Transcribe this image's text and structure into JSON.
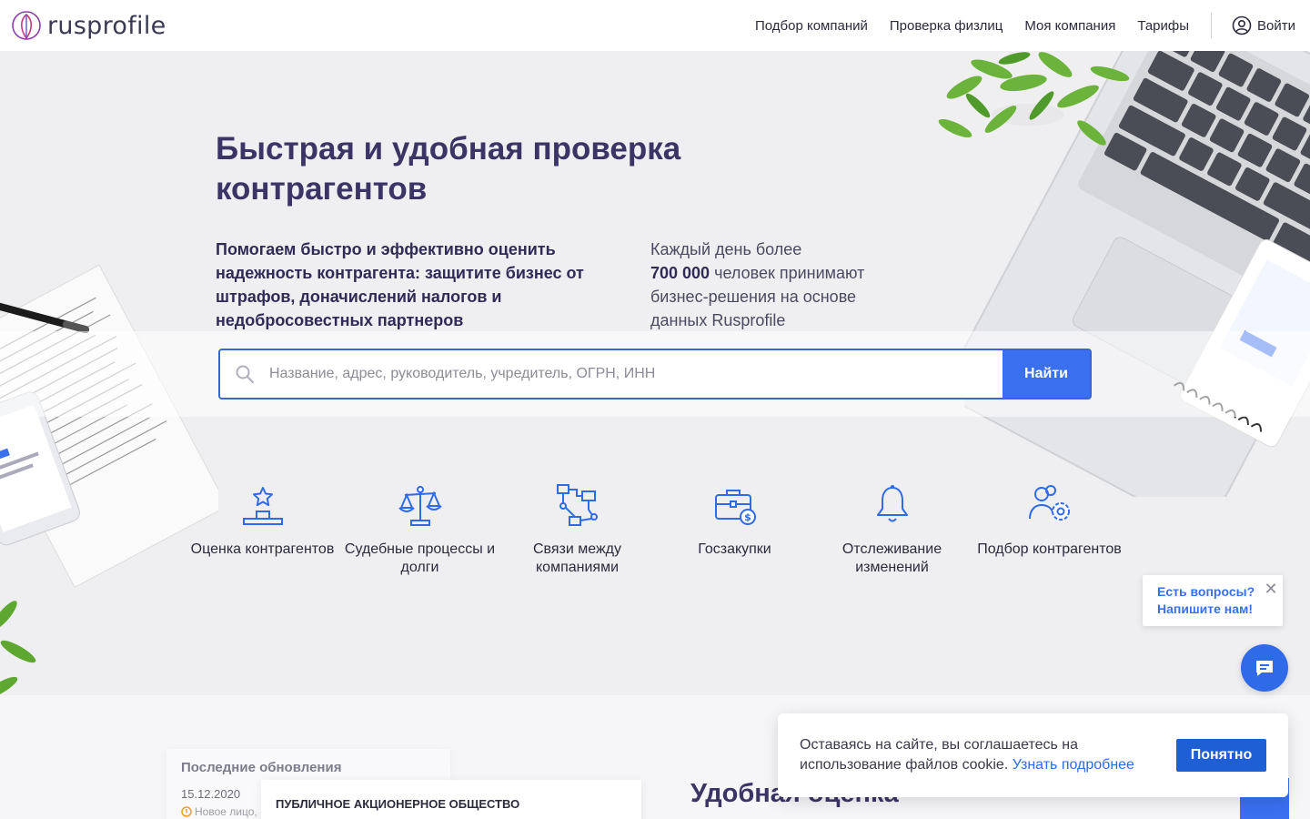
{
  "header": {
    "logo_text": "rusprofile",
    "nav": [
      "Подбор компаний",
      "Проверка физлиц",
      "Моя компания",
      "Тарифы"
    ],
    "login_label": "Войти"
  },
  "hero": {
    "title": "Быстрая и удобная проверка контрагентов",
    "left_text": "Помогаем быстро и эффективно оценить надежность контрагента: защитите бизнес от штрафов, доначислений налогов и недобросовестных партнеров",
    "right_prefix": "Каждый день более",
    "right_highlight": "700 000",
    "right_suffix": "человек принимают бизнес-решения на основе данных Rusprofile"
  },
  "search": {
    "placeholder": "Название, адрес, руководитель, учредитель, ОГРН, ИНН",
    "button": "Найти"
  },
  "features": [
    {
      "label": "Оценка контрагентов",
      "icon": "rating-icon"
    },
    {
      "label": "Судебные процессы и долги",
      "icon": "scales-icon"
    },
    {
      "label": "Связи между компаниями",
      "icon": "connections-icon"
    },
    {
      "label": "Госзакупки",
      "icon": "briefcase-money-icon"
    },
    {
      "label": "Отслеживание изменений",
      "icon": "bell-icon"
    },
    {
      "label": "Подбор контрагентов",
      "icon": "users-gear-icon"
    }
  ],
  "updates": {
    "title": "Последние обновления",
    "date": "15.12.2020",
    "note": "Новое лицо,"
  },
  "company_card": "ПУБЛИЧНОЕ АКЦИОНЕРНОЕ ОБЩЕСТВО",
  "section_title": "Удобная оценка",
  "chat": {
    "line1": "Есть вопросы?",
    "line2": "Напишите нам!"
  },
  "cookie": {
    "text": "Оставаясь на сайте, вы соглашаетесь на использование файлов cookie.",
    "link": "Узнать подробнее",
    "button": "Понятно"
  },
  "colors": {
    "accent": "#3a6ff0",
    "title": "#3b3566",
    "background": "#efeff1"
  }
}
